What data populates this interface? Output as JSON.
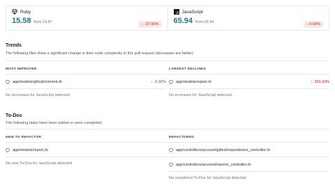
{
  "summary": {
    "ruby": {
      "label": "Ruby",
      "value": "15.58",
      "from": "from 19.87",
      "change": "-27.56%"
    },
    "javascript": {
      "label": "JavaScript",
      "value": "65.94",
      "from": "from 65.94",
      "change": "0.00%"
    }
  },
  "trends": {
    "title": "Trends",
    "description": "The following files show a significant change in their code complexity in this pull request (decreases are better)",
    "most_improved": {
      "header": "MOST IMPROVED",
      "file": "app/models/github/commit.rb",
      "change": "-0.32%",
      "empty": "No decreases for JavaScript detected"
    },
    "largest_declines": {
      "header": "LARGEST DECLINES",
      "file": "app/models/report.rb",
      "change": "393.10%",
      "empty": "No increases for JavaScript detected"
    }
  },
  "todos": {
    "title": "To-Dos",
    "description": "The following tasks have been added or were completed",
    "new_to_refactor": {
      "header": "NEW TO REFACTOR",
      "files": [
        "app/models/report.rb"
      ],
      "empty": "No new To-Dos for JavaScript detected"
    },
    "refactored": {
      "header": "REFACTORED",
      "files": [
        "app/controllers/account/github/repositories_controller.rb",
        "app/controllers/account/reports_controller.rb"
      ],
      "empty": "No completed To-Dos for JavaScript detected"
    }
  },
  "colors": {
    "accent": "#2b6f8e",
    "decrease_badge_bg": "#fde8e8",
    "negative": "#b91c1c",
    "positive": "#15803d"
  }
}
